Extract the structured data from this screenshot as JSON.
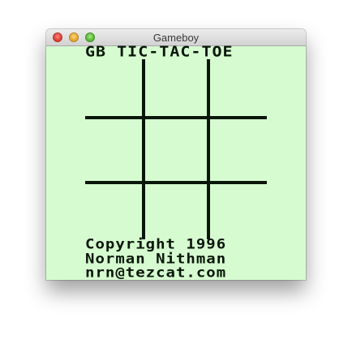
{
  "window": {
    "title": "Gameboy"
  },
  "game": {
    "title": "GB TIC-TAC-TOE",
    "credits": [
      "Copyright 1996",
      "Norman Nithman",
      "nrn@tezcat.com"
    ]
  },
  "colors": {
    "screen_background": "#d6fbd0",
    "ink": "#0a160a"
  }
}
